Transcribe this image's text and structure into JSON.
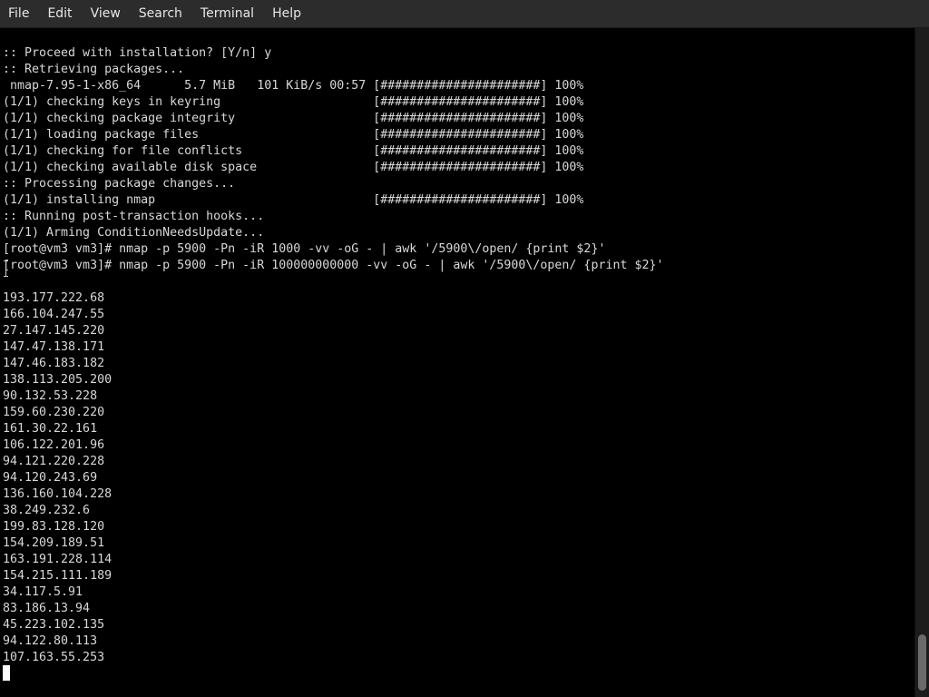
{
  "menu": [
    "File",
    "Edit",
    "View",
    "Search",
    "Terminal",
    "Help"
  ],
  "terminal_lines": [
    ":: Proceed with installation? [Y/n] y",
    ":: Retrieving packages...",
    " nmap-7.95-1-x86_64      5.7 MiB   101 KiB/s 00:57 [######################] 100%",
    "(1/1) checking keys in keyring                     [######################] 100%",
    "(1/1) checking package integrity                   [######################] 100%",
    "(1/1) loading package files                        [######################] 100%",
    "(1/1) checking for file conflicts                  [######################] 100%",
    "(1/1) checking available disk space                [######################] 100%",
    ":: Processing package changes...",
    "(1/1) installing nmap                              [######################] 100%",
    ":: Running post-transaction hooks...",
    "(1/1) Arming ConditionNeedsUpdate...",
    "[root@vm3 vm3]# nmap -p 5900 -Pn -iR 1000 -vv -oG - | awk '/5900\\/open/ {print $2}'",
    "[root@vm3 vm3]# nmap -p 5900 -Pn -iR 100000000000 -vv -oG - | awk '/5900\\/open/ {print $2}'",
    "",
    "193.177.222.68",
    "166.104.247.55",
    "27.147.145.220",
    "147.47.138.171",
    "147.46.183.182",
    "138.113.205.200",
    "90.132.53.228",
    "159.60.230.220",
    "161.30.22.161",
    "106.122.201.96",
    "94.121.220.228",
    "94.120.243.69",
    "136.160.104.228",
    "38.249.232.6",
    "199.83.128.120",
    "154.209.189.51",
    "163.191.228.114",
    "154.215.111.189",
    "34.117.5.91",
    "83.186.13.94",
    "45.223.102.135",
    "94.122.80.113",
    "107.163.55.253"
  ]
}
